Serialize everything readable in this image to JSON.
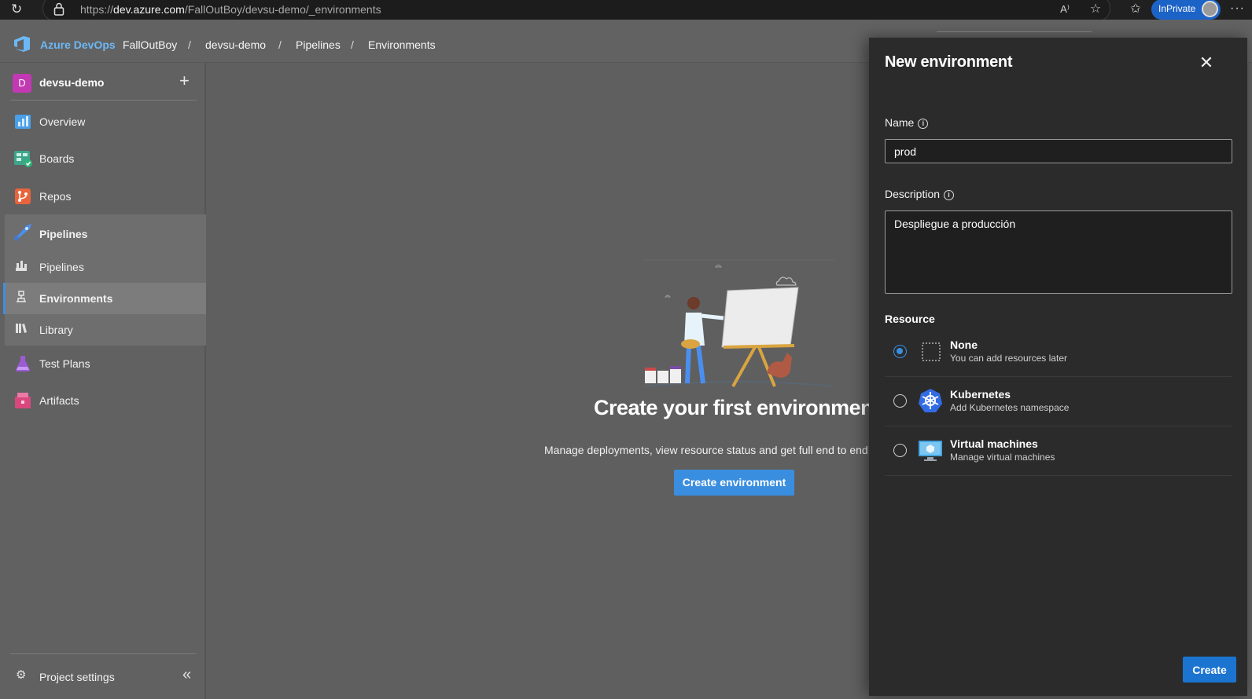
{
  "browser": {
    "url_prefix": "https://",
    "url_host": "dev.azure.com",
    "url_path": "/FallOutBoy/devsu-demo/_environments",
    "inprivate_label": "InPrivate",
    "read_aloud_label": "A⁾"
  },
  "header": {
    "brand": "Azure DevOps",
    "breadcrumbs": [
      "FallOutBoy",
      "devsu-demo",
      "Pipelines",
      "Environments"
    ],
    "separator": "/"
  },
  "sidebar": {
    "project_initial": "D",
    "project_name": "devsu-demo",
    "items": [
      {
        "label": "Overview",
        "icon": "overview-icon"
      },
      {
        "label": "Boards",
        "icon": "boards-icon"
      },
      {
        "label": "Repos",
        "icon": "repos-icon"
      },
      {
        "label": "Pipelines",
        "icon": "pipelines-icon"
      },
      {
        "label": "Pipelines",
        "icon": "pipelines-sub-icon"
      },
      {
        "label": "Environments",
        "icon": "environments-icon"
      },
      {
        "label": "Library",
        "icon": "library-icon"
      },
      {
        "label": "Test Plans",
        "icon": "test-plans-icon"
      },
      {
        "label": "Artifacts",
        "icon": "artifacts-icon"
      }
    ],
    "settings_label": "Project settings"
  },
  "main": {
    "title": "Create your first environment",
    "description": "Manage deployments, view resource status and get full end to end",
    "create_button": "Create environment"
  },
  "panel": {
    "title": "New environment",
    "name_label": "Name",
    "name_value": "prod",
    "description_label": "Description",
    "description_value": "Despliegue a producción",
    "resource_label": "Resource",
    "resources": [
      {
        "title": "None",
        "subtitle": "You can add resources later",
        "selected": true
      },
      {
        "title": "Kubernetes",
        "subtitle": "Add Kubernetes namespace",
        "selected": false
      },
      {
        "title": "Virtual machines",
        "subtitle": "Manage virtual machines",
        "selected": false
      }
    ],
    "create_button": "Create"
  },
  "colors": {
    "accent": "#3a8ee0",
    "brand_text": "#6cb8f6",
    "project_badge": "#c239b3",
    "panel_bg": "#2b2b2b"
  }
}
